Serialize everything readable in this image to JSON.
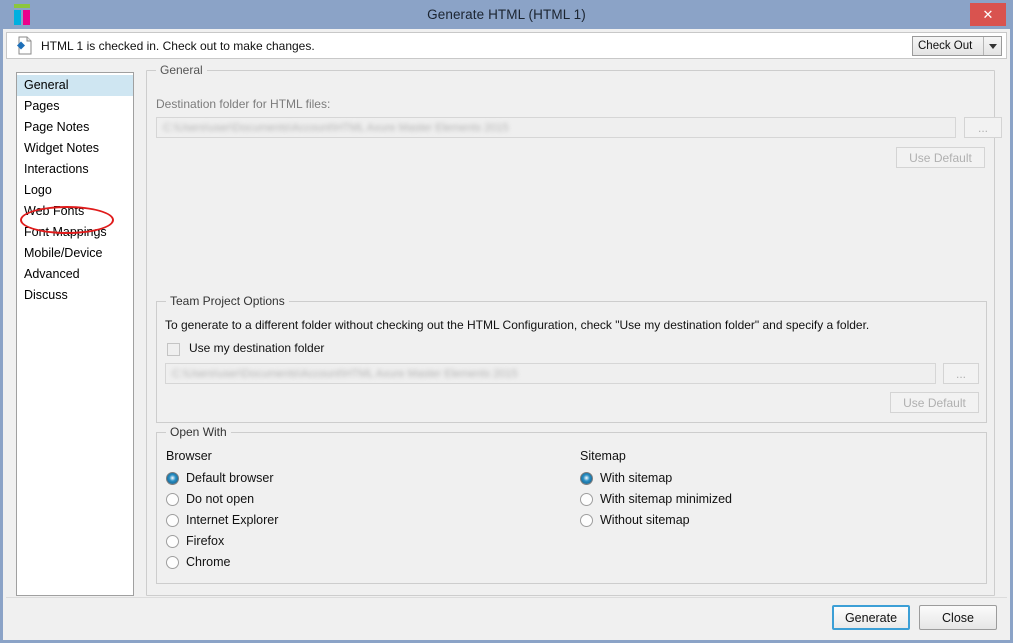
{
  "window": {
    "title": "Generate HTML (HTML 1)",
    "logo_icon": "axure-logo-icon",
    "close_icon": "close-icon"
  },
  "message_bar": {
    "icon": "html-document-icon",
    "text": "HTML 1 is checked in. Check out to make changes.",
    "checkout_dropdown": {
      "selected": "Check Out",
      "arrow_icon": "chevron-down-icon"
    }
  },
  "sidebar": {
    "items": [
      {
        "label": "General",
        "selected": true
      },
      {
        "label": "Pages",
        "selected": false
      },
      {
        "label": "Page Notes",
        "selected": false
      },
      {
        "label": "Widget Notes",
        "selected": false
      },
      {
        "label": "Interactions",
        "selected": false
      },
      {
        "label": "Logo",
        "selected": false
      },
      {
        "label": "Web Fonts",
        "selected": false
      },
      {
        "label": "Font Mappings",
        "selected": false
      },
      {
        "label": "Mobile/Device",
        "selected": false
      },
      {
        "label": "Advanced",
        "selected": false
      },
      {
        "label": "Discuss",
        "selected": false
      }
    ],
    "annotation": {
      "shape": "ellipse",
      "color": "#e01b1b",
      "targets_item": "Web Fonts"
    }
  },
  "general": {
    "legend": "General",
    "destination_label": "Destination folder for HTML files:",
    "destination_value": "C:\\Users\\user\\Documents\\Account\\HTML Axure Master Elements 2015",
    "browse_label": "...",
    "use_default_label": "Use Default"
  },
  "team_project": {
    "legend": "Team Project Options",
    "description": "To generate to a different folder without checking out the HTML Configuration, check \"Use my destination folder\" and specify a folder.",
    "checkbox_label": "Use my destination folder",
    "checkbox_checked": false,
    "folder_value": "C:\\Users\\user\\Documents\\Account\\HTML Axure Master Elements 2015",
    "browse_label": "...",
    "use_default_label": "Use Default"
  },
  "open_with": {
    "legend": "Open With",
    "browser": {
      "title": "Browser",
      "options": [
        {
          "label": "Default browser",
          "selected": true
        },
        {
          "label": "Do not open",
          "selected": false
        },
        {
          "label": "Internet Explorer",
          "selected": false
        },
        {
          "label": "Firefox",
          "selected": false
        },
        {
          "label": "Chrome",
          "selected": false
        }
      ]
    },
    "sitemap": {
      "title": "Sitemap",
      "options": [
        {
          "label": "With sitemap",
          "selected": true
        },
        {
          "label": "With sitemap minimized",
          "selected": false
        },
        {
          "label": "Without sitemap",
          "selected": false
        }
      ]
    }
  },
  "footer": {
    "generate_label": "Generate",
    "close_label": "Close"
  },
  "colors": {
    "titlebar": "#8ba3c7",
    "close_button": "#d9534f",
    "selection": "#cfe6f2",
    "annotation": "#e01b1b",
    "accent": "#2a8fc4"
  }
}
